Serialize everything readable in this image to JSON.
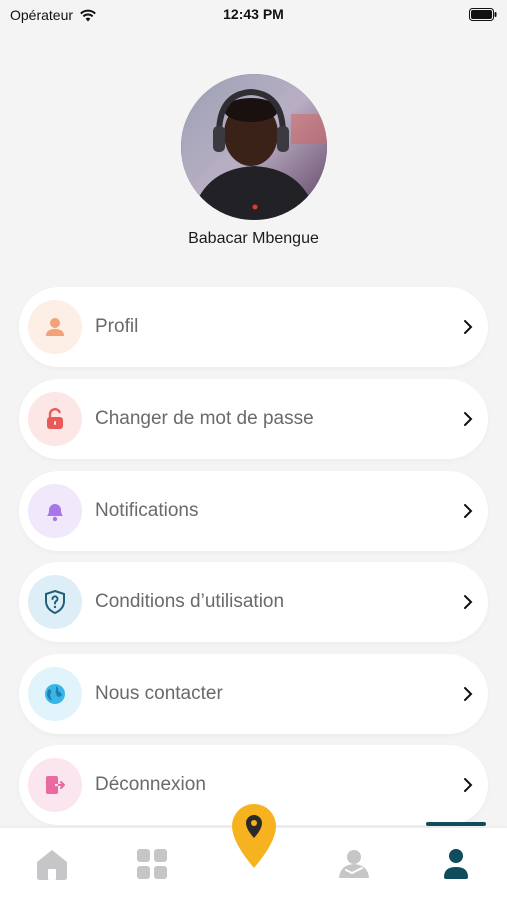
{
  "status_bar": {
    "carrier": "Opérateur",
    "time": "12:43 PM"
  },
  "profile": {
    "name": "Babacar Mbengue"
  },
  "menu": {
    "items": [
      {
        "label": "Profil",
        "icon": "user-icon",
        "icon_color": "#f2a27a",
        "bg_color": "#fdeee6"
      },
      {
        "label": "Changer de mot de passe",
        "icon": "unlock-icon",
        "icon_color": "#e85a5a",
        "bg_color": "#fde6e6"
      },
      {
        "label": "Notifications",
        "icon": "bell-icon",
        "icon_color": "#a876e8",
        "bg_color": "#f0e8fb"
      },
      {
        "label": "Conditions d’utilisation",
        "icon": "shield-question-icon",
        "icon_color": "#1f5f79",
        "bg_color": "#deeef7"
      },
      {
        "label": "Nous contacter",
        "icon": "globe-icon",
        "icon_color": "#39b6e8",
        "bg_color": "#e2f4fb"
      },
      {
        "label": "Déconnexion",
        "icon": "logout-icon",
        "icon_color": "#e86aa0",
        "bg_color": "#fbe6ef"
      }
    ]
  },
  "bottom_nav": {
    "tabs": [
      "home-icon",
      "grid-icon",
      "map-pin-icon",
      "handshake-icon",
      "user-icon"
    ],
    "active": "user-icon",
    "active_color": "#0f4c5c",
    "fab_color": "#f6b21f"
  }
}
